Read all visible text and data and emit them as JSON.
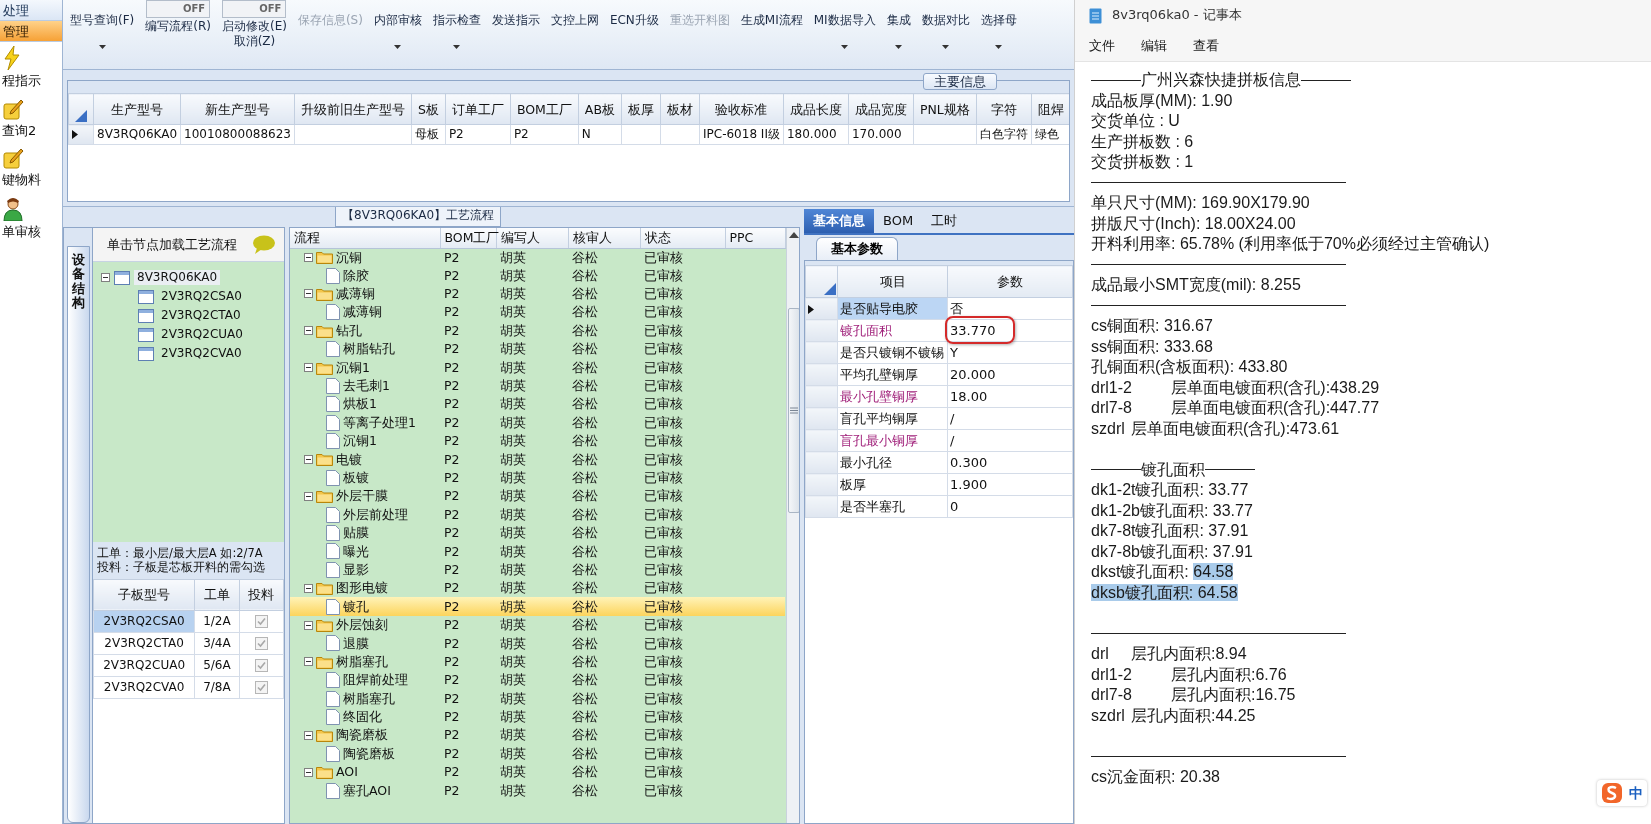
{
  "sidebar": {
    "items": [
      {
        "kind": "header",
        "label": "处理",
        "selected": false
      },
      {
        "kind": "header",
        "label": "管理",
        "selected": true
      },
      {
        "kind": "bolt",
        "label": "程指示",
        "selected": false
      },
      {
        "kind": "note",
        "label": "查询2",
        "selected": false
      },
      {
        "kind": "note",
        "label": "键物料",
        "selected": false
      },
      {
        "kind": "person",
        "label": "单审核",
        "selected": false
      }
    ]
  },
  "toolbar": {
    "items": [
      {
        "kind": "button",
        "label": "型号查询(F)",
        "dropdown": true,
        "disabled": false
      },
      {
        "kind": "toggle",
        "switch_text": "OFF",
        "on": false,
        "label": "编写流程(R)"
      },
      {
        "kind": "toggle",
        "switch_text": "OFF",
        "on": false,
        "label": "启动修改(E)",
        "sublabel": "取消(Z)"
      },
      {
        "kind": "button",
        "label": "保存信息(S)",
        "dropdown": false,
        "disabled": true
      },
      {
        "kind": "button",
        "label": "内部审核",
        "dropdown": true,
        "disabled": false
      },
      {
        "kind": "button",
        "label": "指示检查",
        "dropdown": true,
        "disabled": false
      },
      {
        "kind": "button",
        "label": "发送指示",
        "dropdown": false,
        "disabled": false
      },
      {
        "kind": "button",
        "label": "文控上网",
        "dropdown": false,
        "disabled": false
      },
      {
        "kind": "button",
        "label": "ECN升级",
        "dropdown": false,
        "disabled": false
      },
      {
        "kind": "button",
        "label": "重选开料图",
        "dropdown": false,
        "disabled": true
      },
      {
        "kind": "button",
        "label": "生成MI流程",
        "dropdown": false,
        "disabled": false
      },
      {
        "kind": "button",
        "label": "MI数据导入",
        "dropdown": true,
        "disabled": false
      },
      {
        "kind": "button",
        "label": "集成",
        "dropdown": true,
        "disabled": false
      },
      {
        "kind": "button",
        "label": "数据对比",
        "dropdown": true,
        "disabled": false
      },
      {
        "kind": "button",
        "label": "选择母",
        "dropdown": true,
        "disabled": false
      }
    ]
  },
  "main_info": {
    "title": "主要信息",
    "columns": [
      "生产型号",
      "新生产型号",
      "升级前旧生产型号",
      "S板",
      "订单工厂",
      "BOM工厂",
      "AB板",
      "板厚",
      "板材",
      "验收标准",
      "成品长度",
      "成品宽度",
      "PNL规格",
      "字符",
      "阻焊"
    ],
    "rows": [
      {
        "current": true,
        "cells": [
          "8V3RQ06KA0",
          "10010800088623",
          null,
          "母板",
          "P2",
          "P2",
          "N",
          null,
          null,
          "IPC-6018 II级",
          "180.000",
          "170.000",
          null,
          "白色字符",
          "绿色"
        ]
      }
    ]
  },
  "process": {
    "title": "【8V3RQ06KA0】工艺流程",
    "side_tab": "设备结构",
    "hint": "单击节点加载工艺流程",
    "tree": [
      {
        "label": "8V3RQ06KA0",
        "expanded": true,
        "selected": true,
        "children": [
          {
            "label": "2V3RQ2CSA0",
            "selected": false
          },
          {
            "label": "2V3RQ2CTA0",
            "selected": false
          },
          {
            "label": "2V3RQ2CUA0",
            "selected": false
          },
          {
            "label": "2V3RQ2CVA0",
            "selected": false
          }
        ]
      }
    ],
    "notes": [
      "工单：最小层/最大层A 如:2/7A",
      "投料：子板是芯板开料的需勾选"
    ],
    "subgrid": {
      "columns": [
        "子板型号",
        "工单",
        "投料"
      ],
      "rows": [
        {
          "board": "2V3RQ2CSA0",
          "order": "1/2A",
          "feed": true,
          "disabled": true,
          "selected": true
        },
        {
          "board": "2V3RQ2CTA0",
          "order": "3/4A",
          "feed": true,
          "disabled": true,
          "selected": false
        },
        {
          "board": "2V3RQ2CUA0",
          "order": "5/6A",
          "feed": true,
          "disabled": true,
          "selected": false
        },
        {
          "board": "2V3RQ2CVA0",
          "order": "7/8A",
          "feed": true,
          "disabled": true,
          "selected": false
        }
      ]
    }
  },
  "flow": {
    "columns": [
      "流程",
      "BOM工厂",
      "编写人",
      "核审人",
      "状态",
      "PPC"
    ],
    "rows": [
      {
        "kind": "folder",
        "name": "沉铜",
        "expanded": true,
        "bom": "P2",
        "writer": "胡英",
        "reviewer": "谷松",
        "status": "已审核",
        "selected": false,
        "children": [
          {
            "kind": "step",
            "name": "除胶",
            "bom": "P2",
            "writer": "胡英",
            "reviewer": "谷松",
            "status": "已审核",
            "selected": false
          }
        ]
      },
      {
        "kind": "folder",
        "name": "减薄铜",
        "expanded": true,
        "bom": "P2",
        "writer": "胡英",
        "reviewer": "谷松",
        "status": "已审核",
        "selected": false,
        "children": [
          {
            "kind": "step",
            "name": "减薄铜",
            "bom": "P2",
            "writer": "胡英",
            "reviewer": "谷松",
            "status": "已审核",
            "selected": false
          }
        ]
      },
      {
        "kind": "folder",
        "name": "钻孔",
        "expanded": true,
        "bom": "P2",
        "writer": "胡英",
        "reviewer": "谷松",
        "status": "已审核",
        "selected": false,
        "children": [
          {
            "kind": "step",
            "name": "树脂钻孔",
            "bom": "P2",
            "writer": "胡英",
            "reviewer": "谷松",
            "status": "已审核",
            "selected": false
          }
        ]
      },
      {
        "kind": "folder",
        "name": "沉铜1",
        "expanded": true,
        "bom": "P2",
        "writer": "胡英",
        "reviewer": "谷松",
        "status": "已审核",
        "selected": false,
        "children": [
          {
            "kind": "step",
            "name": "去毛刺1",
            "bom": "P2",
            "writer": "胡英",
            "reviewer": "谷松",
            "status": "已审核",
            "selected": false
          },
          {
            "kind": "step",
            "name": "烘板1",
            "bom": "P2",
            "writer": "胡英",
            "reviewer": "谷松",
            "status": "已审核",
            "selected": false
          },
          {
            "kind": "step",
            "name": "等离子处理1",
            "bom": "P2",
            "writer": "胡英",
            "reviewer": "谷松",
            "status": "已审核",
            "selected": false
          },
          {
            "kind": "step",
            "name": "沉铜1",
            "bom": "P2",
            "writer": "胡英",
            "reviewer": "谷松",
            "status": "已审核",
            "selected": false
          }
        ]
      },
      {
        "kind": "folder",
        "name": "电镀",
        "expanded": true,
        "bom": "P2",
        "writer": "胡英",
        "reviewer": "谷松",
        "status": "已审核",
        "selected": false,
        "children": [
          {
            "kind": "step",
            "name": "板镀",
            "bom": "P2",
            "writer": "胡英",
            "reviewer": "谷松",
            "status": "已审核",
            "selected": false
          }
        ]
      },
      {
        "kind": "folder",
        "name": "外层干膜",
        "expanded": true,
        "bom": "P2",
        "writer": "胡英",
        "reviewer": "谷松",
        "status": "已审核",
        "selected": false,
        "children": [
          {
            "kind": "step",
            "name": "外层前处理",
            "bom": "P2",
            "writer": "胡英",
            "reviewer": "谷松",
            "status": "已审核",
            "selected": false
          },
          {
            "kind": "step",
            "name": "贴膜",
            "bom": "P2",
            "writer": "胡英",
            "reviewer": "谷松",
            "status": "已审核",
            "selected": false
          },
          {
            "kind": "step",
            "name": "曝光",
            "bom": "P2",
            "writer": "胡英",
            "reviewer": "谷松",
            "status": "已审核",
            "selected": false
          },
          {
            "kind": "step",
            "name": "显影",
            "bom": "P2",
            "writer": "胡英",
            "reviewer": "谷松",
            "status": "已审核",
            "selected": false
          }
        ]
      },
      {
        "kind": "folder",
        "name": "图形电镀",
        "expanded": true,
        "bom": "P2",
        "writer": "胡英",
        "reviewer": "谷松",
        "status": "已审核",
        "selected": false,
        "children": [
          {
            "kind": "step",
            "name": "镀孔",
            "bom": "P2",
            "writer": "胡英",
            "reviewer": "谷松",
            "status": "已审核",
            "selected": true
          }
        ]
      },
      {
        "kind": "folder",
        "name": "外层蚀刻",
        "expanded": true,
        "bom": "P2",
        "writer": "胡英",
        "reviewer": "谷松",
        "status": "已审核",
        "selected": false,
        "children": [
          {
            "kind": "step",
            "name": "退膜",
            "bom": "P2",
            "writer": "胡英",
            "reviewer": "谷松",
            "status": "已审核",
            "selected": false
          }
        ]
      },
      {
        "kind": "folder",
        "name": "树脂塞孔",
        "expanded": true,
        "bom": "P2",
        "writer": "胡英",
        "reviewer": "谷松",
        "status": "已审核",
        "selected": false,
        "children": [
          {
            "kind": "step",
            "name": "阻焊前处理",
            "bom": "P2",
            "writer": "胡英",
            "reviewer": "谷松",
            "status": "已审核",
            "selected": false
          },
          {
            "kind": "step",
            "name": "树脂塞孔",
            "bom": "P2",
            "writer": "胡英",
            "reviewer": "谷松",
            "status": "已审核",
            "selected": false
          },
          {
            "kind": "step",
            "name": "终固化",
            "bom": "P2",
            "writer": "胡英",
            "reviewer": "谷松",
            "status": "已审核",
            "selected": false
          }
        ]
      },
      {
        "kind": "folder",
        "name": "陶瓷磨板",
        "expanded": true,
        "bom": "P2",
        "writer": "胡英",
        "reviewer": "谷松",
        "status": "已审核",
        "selected": false,
        "children": [
          {
            "kind": "step",
            "name": "陶瓷磨板",
            "bom": "P2",
            "writer": "胡英",
            "reviewer": "谷松",
            "status": "已审核",
            "selected": false
          }
        ]
      },
      {
        "kind": "folder",
        "name": "AOI",
        "expanded": true,
        "bom": "P2",
        "writer": "胡英",
        "reviewer": "谷松",
        "status": "已审核",
        "selected": false,
        "children": [
          {
            "kind": "step",
            "name": "塞孔AOI",
            "bom": "P2",
            "writer": "胡英",
            "reviewer": "谷松",
            "status": "已审核",
            "selected": false
          }
        ]
      }
    ]
  },
  "detail": {
    "tabs": [
      {
        "label": "基本信息",
        "selected": true
      },
      {
        "label": "BOM",
        "selected": false
      },
      {
        "label": "工时",
        "selected": false
      }
    ],
    "subtabs": [
      {
        "label": "基本参数",
        "selected": true
      }
    ],
    "columns": [
      "项目",
      "参数"
    ],
    "rows": [
      {
        "item": "是否贴导电胶",
        "value": "否",
        "current": true,
        "flagged": false,
        "circled": false
      },
      {
        "item": "镀孔面积",
        "value": "33.770",
        "current": false,
        "flagged": true,
        "circled": true
      },
      {
        "item": "是否只镀铜不镀锡",
        "value": "Y",
        "current": false,
        "flagged": false,
        "circled": false
      },
      {
        "item": "平均孔壁铜厚",
        "value": "20.000",
        "current": false,
        "flagged": false,
        "circled": false
      },
      {
        "item": "最小孔壁铜厚",
        "value": "18.00",
        "current": false,
        "flagged": true,
        "circled": false
      },
      {
        "item": "盲孔平均铜厚",
        "value": "/",
        "current": false,
        "flagged": false,
        "circled": false
      },
      {
        "item": "盲孔最小铜厚",
        "value": "/",
        "current": false,
        "flagged": true,
        "circled": false
      },
      {
        "item": "最小孔径",
        "value": "0.300",
        "current": false,
        "flagged": false,
        "circled": false
      },
      {
        "item": "板厚",
        "value": "1.900",
        "current": false,
        "flagged": false,
        "circled": false
      },
      {
        "item": "是否半塞孔",
        "value": "0",
        "current": false,
        "flagged": false,
        "circled": false
      }
    ]
  },
  "notepad": {
    "title": "8v3rq06ka0 - 记事本",
    "menu": [
      "文件",
      "编辑",
      "查看"
    ],
    "ime": "中",
    "lines": [
      {
        "kind": "titled_rule",
        "text": "广州兴森快捷拼板信息"
      },
      {
        "kind": "text",
        "text": "成品板厚(MM): 1.90"
      },
      {
        "kind": "text",
        "text": "交货单位 : U"
      },
      {
        "kind": "text",
        "text": "生产拼板数 : 6"
      },
      {
        "kind": "text",
        "text": "交货拼板数 : 1"
      },
      {
        "kind": "rule"
      },
      {
        "kind": "text",
        "text": "单只尺寸(MM): 169.90X179.90"
      },
      {
        "kind": "text",
        "text": "拼版尺寸(Inch): 18.00X24.00"
      },
      {
        "kind": "text",
        "text": "开料利用率: 65.78% (利用率低于70%必须经过主管确认)"
      },
      {
        "kind": "rule"
      },
      {
        "kind": "text",
        "text": "成品最小SMT宽度(mil): 8.255"
      },
      {
        "kind": "rule"
      },
      {
        "kind": "text",
        "text": "cs铜面积: 316.67"
      },
      {
        "kind": "text",
        "text": "ss铜面积: 333.68"
      },
      {
        "kind": "text",
        "text": "孔铜面积(含板面积): 433.80"
      },
      {
        "kind": "text",
        "text": "drl1-2\t层单面电镀面积(含孔):438.29"
      },
      {
        "kind": "text",
        "text": "drl7-8\t层单面电镀面积(含孔):447.77"
      },
      {
        "kind": "text",
        "text": "szdrl\t层单面电镀面积(含孔):473.61"
      },
      {
        "kind": "blank"
      },
      {
        "kind": "titled_rule",
        "text": "镀孔面积"
      },
      {
        "kind": "text",
        "text": "dk1-2t镀孔面积: 33.77"
      },
      {
        "kind": "text",
        "text": "dk1-2b镀孔面积: 33.77"
      },
      {
        "kind": "text",
        "text": "dk7-8t镀孔面积: 37.91"
      },
      {
        "kind": "text",
        "text": "dk7-8b镀孔面积: 37.91"
      },
      {
        "kind": "text",
        "parts": [
          {
            "text": "dkst镀孔面积: ",
            "selected": false
          },
          {
            "text": "64.58",
            "selected": true
          }
        ]
      },
      {
        "kind": "text",
        "parts": [
          {
            "text": "dksb镀孔面积: 64.58",
            "selected": true
          }
        ]
      },
      {
        "kind": "blank"
      },
      {
        "kind": "rule"
      },
      {
        "kind": "text",
        "text": "drl\t层孔内面积:8.94"
      },
      {
        "kind": "text",
        "text": "drl1-2\t层孔内面积:6.76"
      },
      {
        "kind": "text",
        "text": "drl7-8\t层孔内面积:16.75"
      },
      {
        "kind": "text",
        "text": "szdrl\t层孔内面积:44.25"
      },
      {
        "kind": "blank"
      },
      {
        "kind": "rule"
      },
      {
        "kind": "text",
        "text": "cs沉金面积: 20.38"
      }
    ]
  }
}
